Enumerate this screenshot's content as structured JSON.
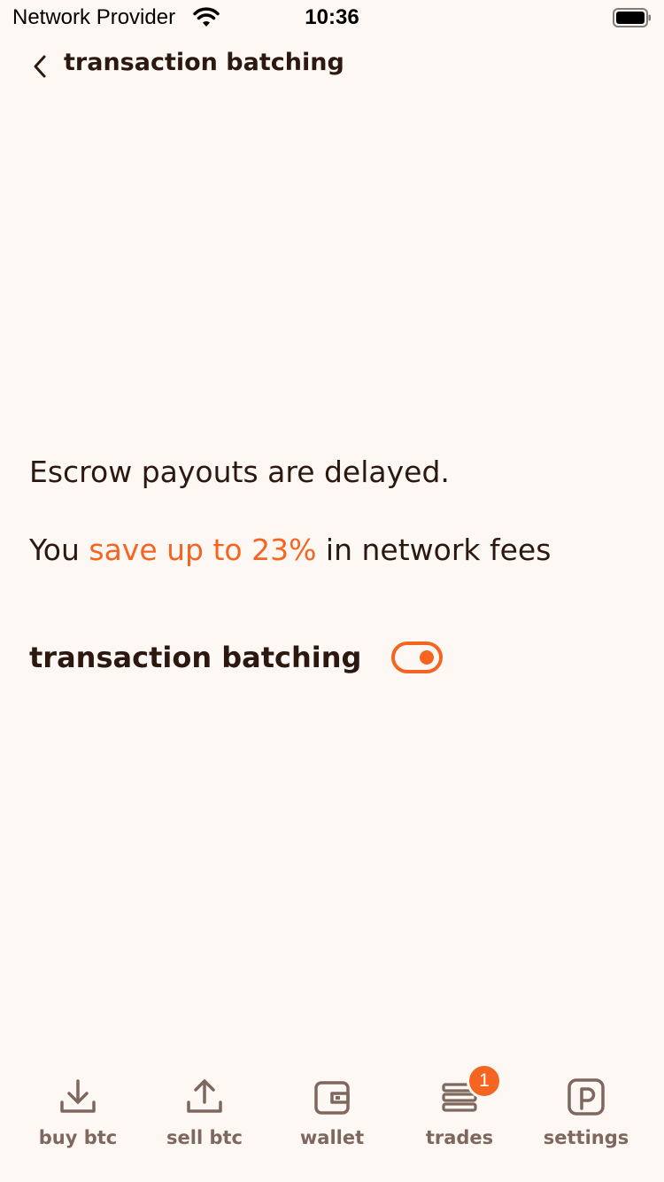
{
  "status_bar": {
    "carrier": "Network Provider",
    "time": "10:36"
  },
  "header": {
    "title": "transaction batching"
  },
  "content": {
    "line1": "Escrow payouts are delayed.",
    "line2_prefix": "You ",
    "line2_highlight": "save up to 23%",
    "line2_suffix": " in network fees"
  },
  "setting": {
    "label": "transaction batching",
    "enabled": true
  },
  "tabs": [
    {
      "label": "buy btc",
      "icon": "download-icon"
    },
    {
      "label": "sell btc",
      "icon": "upload-icon"
    },
    {
      "label": "wallet",
      "icon": "wallet-icon"
    },
    {
      "label": "trades",
      "icon": "trades-icon",
      "badge": "1"
    },
    {
      "label": "settings",
      "icon": "peach-settings-icon"
    }
  ],
  "colors": {
    "background": "#FEF8F4",
    "accent": "#F56522",
    "text": "#2B1911",
    "tab_inactive": "#7D675E"
  }
}
